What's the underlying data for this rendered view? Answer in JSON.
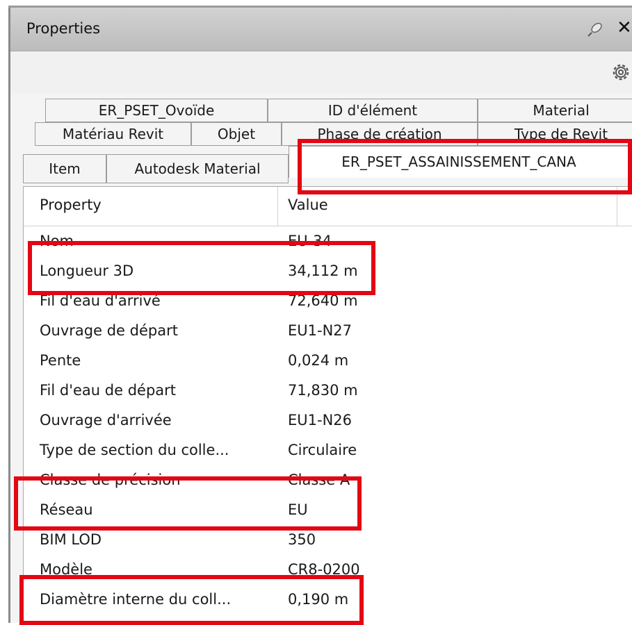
{
  "title": "Properties",
  "tabs": {
    "row1": [
      "ER_PSET_Ovoïde",
      "ID d'élément",
      "Material"
    ],
    "row2": [
      "Matériau Revit",
      "Objet",
      "Phase de création",
      "Type de Revit"
    ],
    "row3": [
      "Item",
      "Autodesk Material",
      "ER_PSET_ASSAINISSEMENT_CANA"
    ]
  },
  "grid": {
    "headers": [
      "Property",
      "Value"
    ],
    "rows": [
      {
        "property": "Nom",
        "value": "EU-34"
      },
      {
        "property": "Longueur 3D",
        "value": "34,112 m"
      },
      {
        "property": "Fil d'eau d'arrivé",
        "value": "72,640 m"
      },
      {
        "property": "Ouvrage de départ",
        "value": "EU1-N27"
      },
      {
        "property": "Pente",
        "value": "0,024 m"
      },
      {
        "property": "Fil d'eau de départ",
        "value": "71,830 m"
      },
      {
        "property": "Ouvrage d'arrivée",
        "value": "EU1-N26"
      },
      {
        "property": "Type de section du colle...",
        "value": "Circulaire"
      },
      {
        "property": "Classe de précision",
        "value": "Classe A"
      },
      {
        "property": "Réseau",
        "value": "EU"
      },
      {
        "property": "BIM LOD",
        "value": "350"
      },
      {
        "property": "Modèle",
        "value": "CR8-0200"
      },
      {
        "property": "Diamètre interne du coll...",
        "value": "0,190 m"
      }
    ]
  },
  "colors": {
    "highlight": "#e30613",
    "titlebar": "#c8c8c8"
  }
}
